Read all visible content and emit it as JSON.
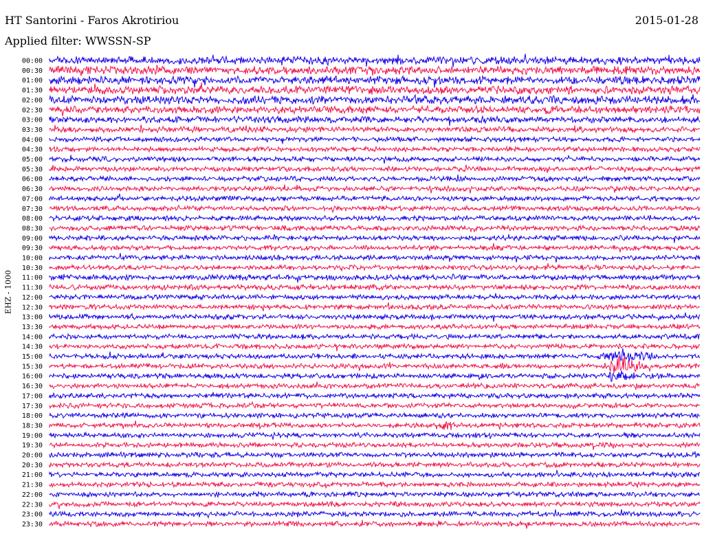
{
  "header": {
    "station": "HT Santorini - Faros Akrotiriou",
    "date": "2015-01-28",
    "filter_label": "Applied filter: WWSSN-SP"
  },
  "chart_data": {
    "type": "line",
    "chart_kind": "helicorder",
    "ylabel": "EHZ - 1000",
    "row_labels": [
      "00:00",
      "00:30",
      "01:00",
      "01:30",
      "02:00",
      "02:30",
      "03:00",
      "03:30",
      "04:00",
      "04:30",
      "05:00",
      "05:30",
      "06:00",
      "06:30",
      "07:00",
      "07:30",
      "08:00",
      "08:30",
      "09:00",
      "09:30",
      "10:00",
      "10:30",
      "11:00",
      "11:30",
      "12:00",
      "12:30",
      "13:00",
      "13:30",
      "14:00",
      "14:30",
      "15:00",
      "15:30",
      "16:00",
      "16:30",
      "17:00",
      "17:30",
      "18:00",
      "18:30",
      "19:00",
      "19:30",
      "20:00",
      "20:30",
      "21:00",
      "21:30",
      "22:00",
      "22:30",
      "23:00",
      "23:30"
    ],
    "trace_colors": [
      "#1400e6",
      "#f0124a"
    ],
    "noise_level": [
      0.95,
      1.0,
      1.0,
      1.0,
      1.0,
      0.9,
      0.8,
      0.7,
      0.6,
      0.6,
      0.6,
      0.6,
      0.6,
      0.6,
      0.6,
      0.6,
      0.6,
      0.6,
      0.6,
      0.6,
      0.6,
      0.6,
      0.65,
      0.65,
      0.6,
      0.6,
      0.6,
      0.6,
      0.6,
      0.6,
      0.6,
      0.6,
      0.6,
      0.6,
      0.6,
      0.6,
      0.6,
      0.6,
      0.6,
      0.6,
      0.6,
      0.6,
      0.6,
      0.6,
      0.6,
      0.6,
      0.6,
      0.6
    ],
    "events": [
      {
        "row": 30,
        "x_fraction": 0.85,
        "width_fraction": 0.075,
        "amplitude": 2.2
      },
      {
        "row": 31,
        "x_fraction": 0.85,
        "width_fraction": 0.075,
        "amplitude": 2.4
      },
      {
        "row": 32,
        "x_fraction": 0.85,
        "width_fraction": 0.065,
        "amplitude": 1.6
      },
      {
        "row": 37,
        "x_fraction": 0.59,
        "width_fraction": 0.04,
        "amplitude": 1.3
      },
      {
        "row": 22,
        "x_fraction": 0.6,
        "width_fraction": 0.04,
        "amplitude": 1.0
      }
    ]
  }
}
